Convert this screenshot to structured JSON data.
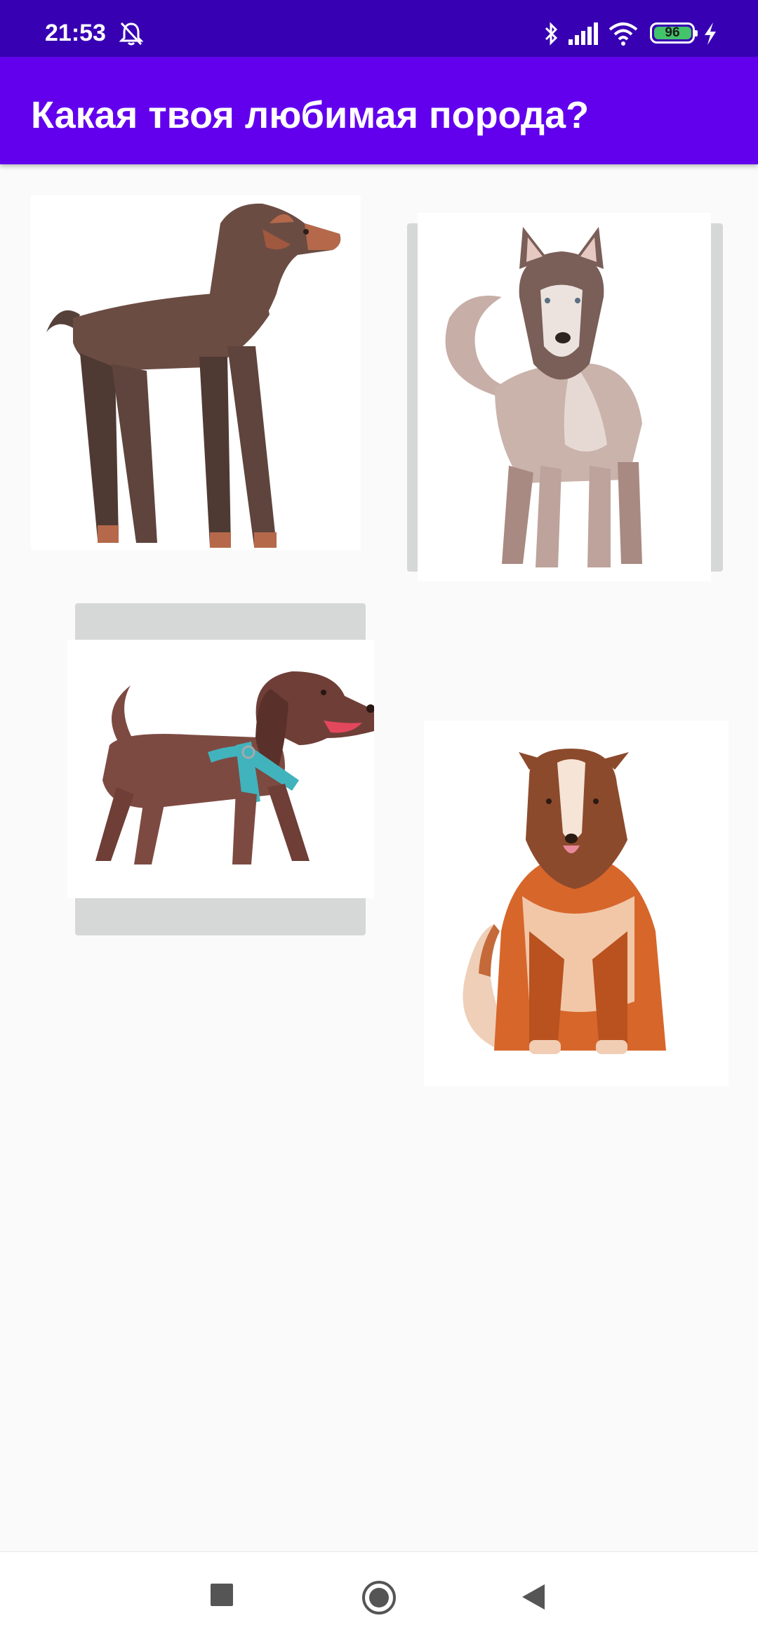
{
  "status_bar": {
    "time": "21:53",
    "battery_level": "96",
    "icons": [
      "bell-off-icon",
      "bluetooth-icon",
      "signal-icon",
      "wifi-icon",
      "battery-icon",
      "charging-icon"
    ]
  },
  "app_bar": {
    "title": "Какая твоя любимая порода?"
  },
  "breeds": [
    {
      "icon": "doberman-image"
    },
    {
      "icon": "husky-image"
    },
    {
      "icon": "dachshund-image"
    },
    {
      "icon": "collie-image"
    }
  ],
  "nav_bar": {
    "icons": [
      "recent-apps-icon",
      "home-icon",
      "back-icon"
    ]
  },
  "colors": {
    "status_bar": "#3700b3",
    "app_bar": "#6200ee",
    "background": "#fafafa"
  }
}
